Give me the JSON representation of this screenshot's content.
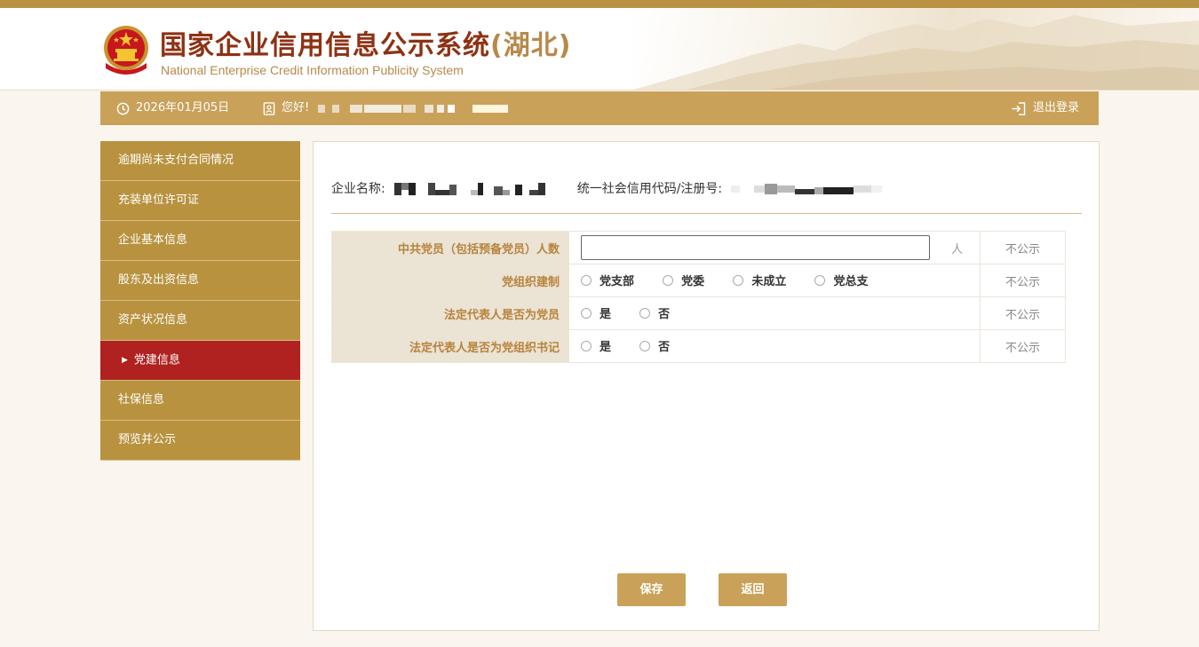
{
  "header": {
    "title": "国家企业信用信息公示系统",
    "province": "(湖北)",
    "title_en": "National Enterprise Credit Information Publicity System"
  },
  "infobar": {
    "date": "2026年01月05日",
    "greeting": "您好!",
    "logout": "退出登录"
  },
  "sidebar": {
    "items": [
      {
        "label": "逾期尚未支付合同情况"
      },
      {
        "label": "充装单位许可证"
      },
      {
        "label": "企业基本信息"
      },
      {
        "label": "股东及出资信息"
      },
      {
        "label": "资产状况信息"
      },
      {
        "label": "党建信息",
        "active": true
      },
      {
        "label": "社保信息"
      },
      {
        "label": "预览并公示"
      }
    ]
  },
  "main": {
    "company_name_label": "企业名称:",
    "credit_code_label": "统一社会信用代码/注册号:",
    "rows": [
      {
        "label": "中共党员（包括预备党员）人数",
        "unit": "人",
        "input_value": "",
        "publicity": "不公示"
      },
      {
        "label": "党组织建制",
        "options": [
          "党支部",
          "党委",
          "未成立",
          "党总支"
        ],
        "publicity": "不公示"
      },
      {
        "label": "法定代表人是否为党员",
        "options": [
          "是",
          "否"
        ],
        "publicity": "不公示"
      },
      {
        "label": "法定代表人是否为党组织书记",
        "options": [
          "是",
          "否"
        ],
        "publicity": "不公示"
      }
    ],
    "save_label": "保存",
    "back_label": "返回"
  },
  "colors": {
    "gold": "#c9a159",
    "nav": "#b8923e",
    "active": "#b0221f",
    "title_red": "#8e3113"
  }
}
